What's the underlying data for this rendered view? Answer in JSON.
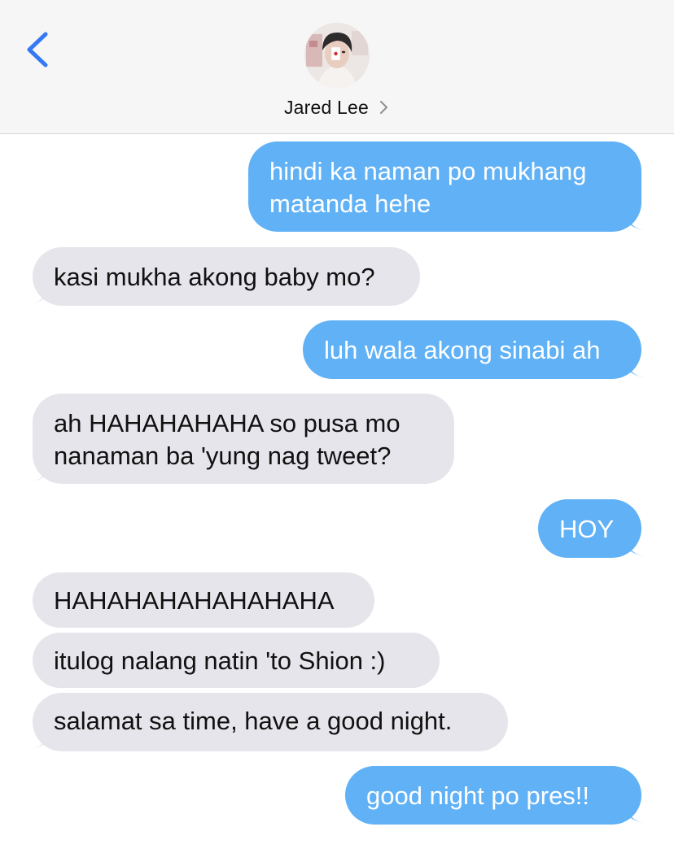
{
  "header": {
    "back_icon": "chevron-left-icon",
    "contact_name": "Jared Lee",
    "details_icon": "chevron-right-icon",
    "accent_color": "#3478f6"
  },
  "colors": {
    "sent_bubble": "#60b1f6",
    "received_bubble": "#e6e5eb"
  },
  "messages": [
    {
      "direction": "sent",
      "text_lines": [
        "hindi ka naman po mukhang",
        "matanda hehe"
      ]
    },
    {
      "direction": "received",
      "text": "kasi mukha akong baby mo?"
    },
    {
      "direction": "sent",
      "text": "luh wala akong sinabi ah"
    },
    {
      "direction": "received",
      "text_lines": [
        "ah HAHAHAHAHA so pusa mo",
        "nanaman ba 'yung nag tweet?"
      ]
    },
    {
      "direction": "sent",
      "text": "HOY"
    },
    {
      "direction": "received",
      "text": "HAHAHAHAHAHAHAHA"
    },
    {
      "direction": "received",
      "text": "itulog nalang natin 'to Shion :)"
    },
    {
      "direction": "received",
      "text": "salamat sa time, have a good night."
    },
    {
      "direction": "sent",
      "text": "good night po pres!!"
    }
  ]
}
